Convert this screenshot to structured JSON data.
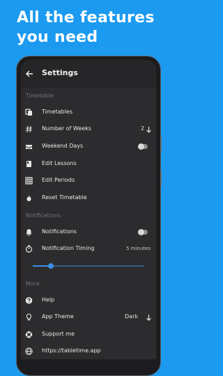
{
  "headline": {
    "line1": "All the features",
    "line2": "you need"
  },
  "colors": {
    "background": "#1b9af0",
    "accent": "#3b8ee8"
  },
  "appbar": {
    "back_icon": "arrow-left-icon",
    "title": "Settings"
  },
  "sections": {
    "timetable": "Timetable",
    "notifications": "Notifications",
    "more": "More"
  },
  "rows": {
    "timetables": {
      "icon": "copy-icon",
      "label": "Timetables"
    },
    "weeks": {
      "icon": "hash-icon",
      "label": "Number of Weeks",
      "value": "2"
    },
    "weekend": {
      "icon": "inbox-icon",
      "label": "Weekend Days",
      "enabled": false
    },
    "lessons": {
      "icon": "book-icon",
      "label": "Edit Lessons"
    },
    "periods": {
      "icon": "grid-icon",
      "label": "Edit Periods"
    },
    "reset": {
      "icon": "fire-icon",
      "label": "Reset Timetable"
    },
    "notifications": {
      "icon": "bell-icon",
      "label": "Notifications",
      "enabled": false
    },
    "timing": {
      "icon": "stopwatch-icon",
      "label": "Notification Timing",
      "value": "5 minutes",
      "slider_fraction": 0.16
    },
    "help": {
      "icon": "help-icon",
      "label": "Help"
    },
    "theme": {
      "icon": "lightbulb-icon",
      "label": "App Theme",
      "value": "Dark"
    },
    "support": {
      "icon": "lifebuoy-icon",
      "label": "Support me"
    },
    "website": {
      "icon": "globe-icon",
      "label": "https://tabletime.app"
    }
  }
}
